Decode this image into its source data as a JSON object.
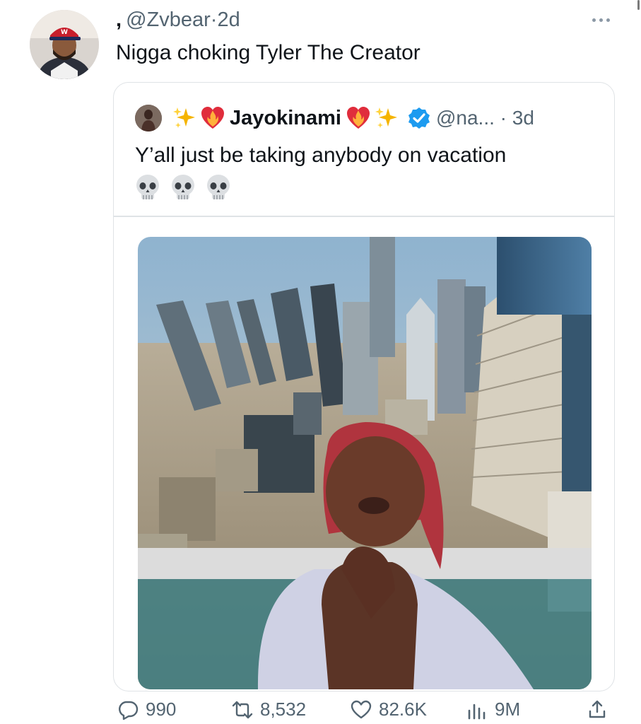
{
  "tweet": {
    "comma": ",",
    "handle": "@Zvbear",
    "separator": "·",
    "time": "2d",
    "text": "Nigga choking Tyler The Creator",
    "avatar_icon": "user-avatar"
  },
  "quote": {
    "display_name": "Jayokinami",
    "handle": "@na...",
    "separator": "·",
    "time": "3d",
    "text": "Y’all just be taking anybody on vacation",
    "verified": true,
    "emojis": [
      "sparkles",
      "heart-on-fire",
      "heart-on-fire",
      "sparkles"
    ],
    "reaction_emojis": [
      "skull",
      "skull",
      "skull"
    ],
    "image_description_icon": "city-skyline-photo"
  },
  "actions": {
    "replies": "990",
    "retweets": "8,532",
    "likes": "82.6K",
    "views": "9M"
  },
  "colors": {
    "text_primary": "#0f1419",
    "text_secondary": "#536471",
    "verified_blue": "#1d9bf0",
    "border": "#dfe3e6"
  }
}
